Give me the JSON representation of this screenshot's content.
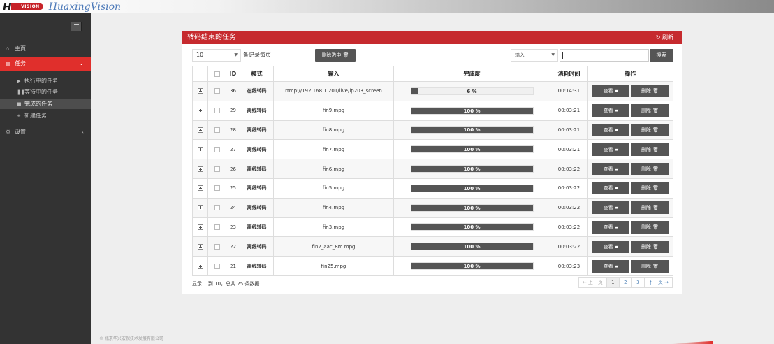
{
  "logo": {
    "hx_h": "H",
    "hx_x": "X",
    "badge": "VISION",
    "script": "HuaxingVision"
  },
  "sidebar": {
    "items": [
      {
        "icon": "home-icon",
        "glyph": "⌂",
        "label": "主页"
      },
      {
        "icon": "list-icon",
        "glyph": "▤",
        "label": "任务"
      },
      {
        "icon": "gear-icon",
        "glyph": "⚙",
        "label": "设置"
      }
    ],
    "task_caret": "⌄",
    "settings_caret": "‹",
    "sub": [
      {
        "icon": "play-icon",
        "glyph": "▶",
        "label": "执行中的任务"
      },
      {
        "icon": "pause-icon",
        "glyph": "❚❚",
        "label": "等待中的任务"
      },
      {
        "icon": "stop-icon",
        "glyph": "■",
        "label": "完成的任务"
      },
      {
        "icon": "plus-icon",
        "glyph": "+",
        "label": "新建任务"
      }
    ]
  },
  "panel": {
    "title": "转码结束的任务",
    "refresh_icon": "↻",
    "refresh": "刷新"
  },
  "controls": {
    "page_length": "10",
    "length_label": "条记录每页",
    "delete_selected": "删除选中",
    "search_column": "输入",
    "search_value": "",
    "search_button": "搜索"
  },
  "table": {
    "headers": {
      "id": "ID",
      "mode": "模式",
      "input": "输入",
      "progress": "完成度",
      "elapsed": "消耗时间",
      "actions": "操作"
    },
    "view_label": "查看",
    "delete_label": "删除",
    "rows": [
      {
        "id": "36",
        "mode": "在线转码",
        "input": "rtmp://192.168.1.201/live/ip203_screen",
        "progress_text": "6 %",
        "progress": 6,
        "elapsed": "00:14:31"
      },
      {
        "id": "29",
        "mode": "离线转码",
        "input": "fin9.mpg",
        "progress_text": "100 %",
        "progress": 100,
        "elapsed": "00:03:21"
      },
      {
        "id": "28",
        "mode": "离线转码",
        "input": "fin8.mpg",
        "progress_text": "100 %",
        "progress": 100,
        "elapsed": "00:03:21"
      },
      {
        "id": "27",
        "mode": "离线转码",
        "input": "fin7.mpg",
        "progress_text": "100 %",
        "progress": 100,
        "elapsed": "00:03:21"
      },
      {
        "id": "26",
        "mode": "离线转码",
        "input": "fin6.mpg",
        "progress_text": "100 %",
        "progress": 100,
        "elapsed": "00:03:22"
      },
      {
        "id": "25",
        "mode": "离线转码",
        "input": "fin5.mpg",
        "progress_text": "100 %",
        "progress": 100,
        "elapsed": "00:03:22"
      },
      {
        "id": "24",
        "mode": "离线转码",
        "input": "fin4.mpg",
        "progress_text": "100 %",
        "progress": 100,
        "elapsed": "00:03:22"
      },
      {
        "id": "23",
        "mode": "离线转码",
        "input": "fin3.mpg",
        "progress_text": "100 %",
        "progress": 100,
        "elapsed": "00:03:22"
      },
      {
        "id": "22",
        "mode": "离线转码",
        "input": "fin2_aac_8m.mpg",
        "progress_text": "100 %",
        "progress": 100,
        "elapsed": "00:03:22"
      },
      {
        "id": "21",
        "mode": "离线转码",
        "input": "fin25.mpg",
        "progress_text": "100 %",
        "progress": 100,
        "elapsed": "00:03:23"
      }
    ]
  },
  "info": "显示 1 到 10，总共 25 条数据",
  "pager": {
    "prev": "← 上一页",
    "pages": [
      "1",
      "2",
      "3"
    ],
    "current": "1",
    "next": "下一页 →"
  },
  "footer": "© 北京华兴宏视技术发展有限公司",
  "colors": {
    "accent": "#e02f2c",
    "panel_header": "#c62a2e",
    "sidebar": "#333333",
    "button": "#555555"
  }
}
